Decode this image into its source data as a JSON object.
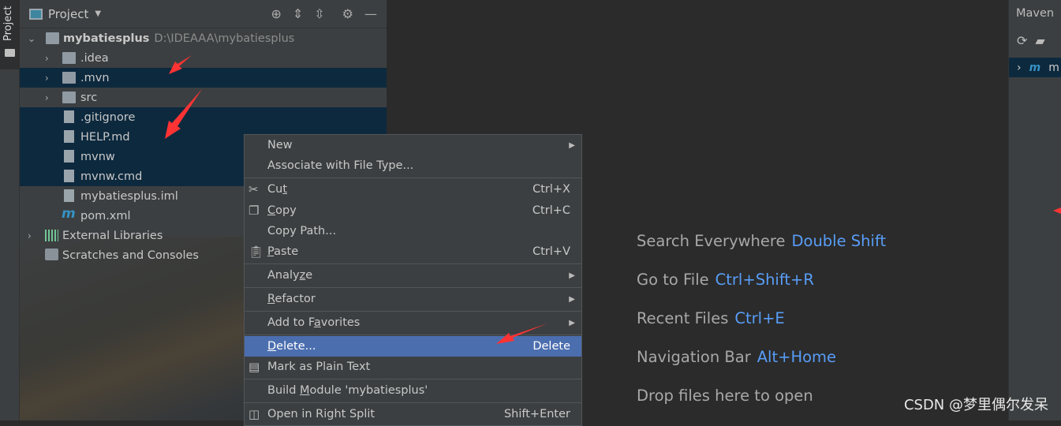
{
  "sidebar_strip": {
    "tab": "Project"
  },
  "project": {
    "title": "Project",
    "tools": [
      "locate-icon",
      "expand-all-icon",
      "collapse-all-icon",
      "gear-icon",
      "minimize-icon"
    ],
    "root": {
      "name": "mybatiesplus",
      "path": "D:\\IDEAAA\\mybatiesplus"
    },
    "items": [
      {
        "label": ".idea",
        "type": "folder",
        "selected": false
      },
      {
        "label": ".mvn",
        "type": "folder",
        "selected": true
      },
      {
        "label": "src",
        "type": "folder",
        "selected": false
      },
      {
        "label": ".gitignore",
        "type": "file",
        "selected": true
      },
      {
        "label": "HELP.md",
        "type": "file",
        "selected": true
      },
      {
        "label": "mvnw",
        "type": "file",
        "selected": true
      },
      {
        "label": "mvnw.cmd",
        "type": "file",
        "selected": true
      },
      {
        "label": "mybatiesplus.iml",
        "type": "file",
        "selected": false
      },
      {
        "label": "pom.xml",
        "type": "maven",
        "selected": false
      }
    ],
    "external": "External Libraries",
    "scratches": "Scratches and Consoles"
  },
  "menu": {
    "new": "New",
    "associate": "Associate with File Type...",
    "cut": "Cu",
    "cut_u": "t",
    "cut_key": "Ctrl+X",
    "copy_u": "C",
    "copy": "opy",
    "copy_key": "Ctrl+C",
    "copy_path": "Copy Path...",
    "paste_u": "P",
    "paste": "aste",
    "paste_key": "Ctrl+V",
    "analyze": "Analy",
    "analyze_u": "z",
    "analyze_end": "e",
    "refactor_u": "R",
    "refactor": "efactor",
    "fav": "Add to F",
    "fav_u": "a",
    "fav_end": "vorites",
    "delete_u": "D",
    "delete": "elete...",
    "delete_key": "Delete",
    "mark": "Mark as Plain Text",
    "build": "Build ",
    "build_u": "M",
    "build_end": "odule 'mybatiesplus'",
    "split": "Open in Right Split",
    "split_key": "Shift+Enter"
  },
  "editor": {
    "hints": [
      {
        "label": "Search Everywhere",
        "key": "Double Shift"
      },
      {
        "label": "Go to File",
        "key": "Ctrl+Shift+R"
      },
      {
        "label": "Recent Files",
        "key": "Ctrl+E"
      },
      {
        "label": "Navigation Bar",
        "key": "Alt+Home"
      },
      {
        "label": "Drop files here to open",
        "key": ""
      }
    ]
  },
  "maven": {
    "title": "Maven",
    "row": "m"
  },
  "watermark": "CSDN @梦里偶尔发呆",
  "colors": {
    "selection": "#0d293e",
    "highlight": "#4b6eaf",
    "shortcut": "#589df6",
    "annotation": "#ff3333"
  }
}
